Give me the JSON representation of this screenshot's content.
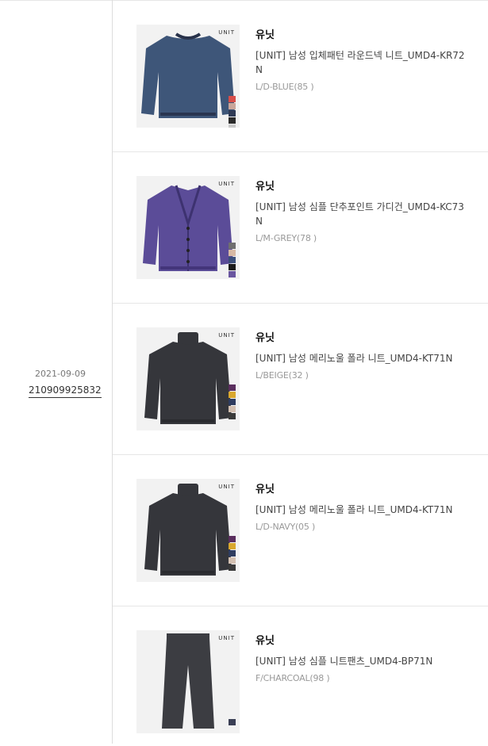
{
  "order": {
    "date": "2021-09-09",
    "number": "210909925832"
  },
  "items": [
    {
      "brand": "유닛",
      "name": "[UNIT] 남성 입체패턴 라운드넥 니트_UMD4-KR72N",
      "option": "L/D-BLUE(85 )",
      "logo": "UNIT",
      "garment": "crewneck-sweater",
      "color": "#3e5679",
      "swatches": [
        "#d74e4a",
        "#c9a59a",
        "#2f3a55",
        "#2b2b2b",
        "#c8c8c8"
      ]
    },
    {
      "brand": "유닛",
      "name": "[UNIT] 남성 심플 단추포인트 가디건_UMD4-KC73N",
      "option": "L/M-GREY(78 )",
      "logo": "UNIT",
      "garment": "cardigan",
      "color": "#5b4c98",
      "swatches": [
        "#6f6f6f",
        "#d7b9a4",
        "#3b4f7a",
        "#1a1a1a",
        "#6a56a0"
      ]
    },
    {
      "brand": "유닛",
      "name": "[UNIT] 남성 메리노울 폴라 니트_UMD4-KT71N",
      "option": "L/BEIGE(32 )",
      "logo": "UNIT",
      "garment": "turtleneck",
      "color": "#35363b",
      "swatches": [
        "#5a2e5e",
        "#d9a72e",
        "#2e3c60",
        "#d3c0b2",
        "#3a3a3a"
      ]
    },
    {
      "brand": "유닛",
      "name": "[UNIT] 남성 메리노울 폴라 니트_UMD4-KT71N",
      "option": "L/D-NAVY(05 )",
      "logo": "UNIT",
      "garment": "turtleneck",
      "color": "#35363b",
      "swatches": [
        "#5a2e5e",
        "#d9a72e",
        "#2e3c60",
        "#d3c0b2",
        "#3a3a3a"
      ]
    },
    {
      "brand": "유닛",
      "name": "[UNIT] 남성 심플 니트팬츠_UMD4-BP71N",
      "option": "F/CHARCOAL(98 )",
      "logo": "UNIT",
      "garment": "pants",
      "color": "#3c3d42",
      "swatches": [
        "#3a3f55"
      ]
    }
  ]
}
